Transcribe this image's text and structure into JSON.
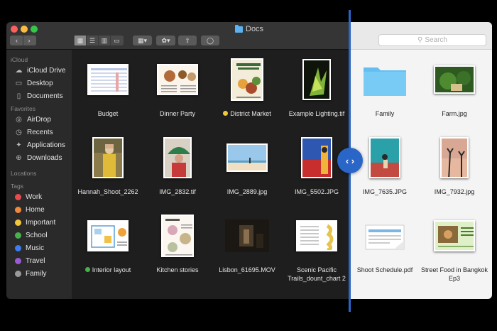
{
  "window": {
    "title": "Docs"
  },
  "toolbar": {
    "back": "‹",
    "forward": "›",
    "view_modes": [
      "▦",
      "☰",
      "▥",
      "▭"
    ],
    "group": "▦▾",
    "action": "✿▾",
    "share": "⇧",
    "tag": "◯",
    "search_placeholder": "Search"
  },
  "sidebar": {
    "sections": [
      {
        "heading": "iCloud",
        "items": [
          {
            "label": "iCloud Drive",
            "icon": "cloud-icon"
          },
          {
            "label": "Desktop",
            "icon": "desktop-icon"
          },
          {
            "label": "Documents",
            "icon": "document-icon"
          }
        ]
      },
      {
        "heading": "Favorites",
        "items": [
          {
            "label": "AirDrop",
            "icon": "airdrop-icon"
          },
          {
            "label": "Recents",
            "icon": "clock-icon"
          },
          {
            "label": "Applications",
            "icon": "applications-icon"
          },
          {
            "label": "Downloads",
            "icon": "download-icon"
          }
        ]
      },
      {
        "heading": "Locations",
        "items": []
      },
      {
        "heading": "Tags",
        "items": [
          {
            "label": "Work",
            "color": "#e74c4c"
          },
          {
            "label": "Home",
            "color": "#f08a3a"
          },
          {
            "label": "Important",
            "color": "#f2c73b"
          },
          {
            "label": "School",
            "color": "#48b14c"
          },
          {
            "label": "Music",
            "color": "#3d7df0"
          },
          {
            "label": "Travel",
            "color": "#9a5ad6"
          },
          {
            "label": "Family",
            "color": "#9a9a9a"
          }
        ]
      }
    ]
  },
  "files_dark": [
    {
      "name": "Budget"
    },
    {
      "name": "Dinner Party"
    },
    {
      "name": "District Market",
      "tag_color": "#f2c73b"
    },
    {
      "name": "Example Lighting.tif"
    },
    {
      "name": "Hannah_Shoot_2262"
    },
    {
      "name": "IMG_2832.tif"
    },
    {
      "name": "IMG_2889.jpg"
    },
    {
      "name": "IMG_5502.JPG"
    },
    {
      "name": "Interior layout",
      "tag_color": "#48b14c"
    },
    {
      "name": "Kitchen stories"
    },
    {
      "name": "Lisbon_61695.MOV"
    },
    {
      "name": "Scenic Pacific Trails_dount_chart 2"
    }
  ],
  "files_light": [
    {
      "name": "Family"
    },
    {
      "name": "Farm.jpg"
    },
    {
      "name": "IMG_7635.JPG"
    },
    {
      "name": "IMG_7932.jpg"
    },
    {
      "name": "Shoot Schedule.pdf"
    },
    {
      "name": "Street Food in Bangkok Ep3"
    }
  ],
  "slider": {
    "handle": "‹ ›"
  }
}
